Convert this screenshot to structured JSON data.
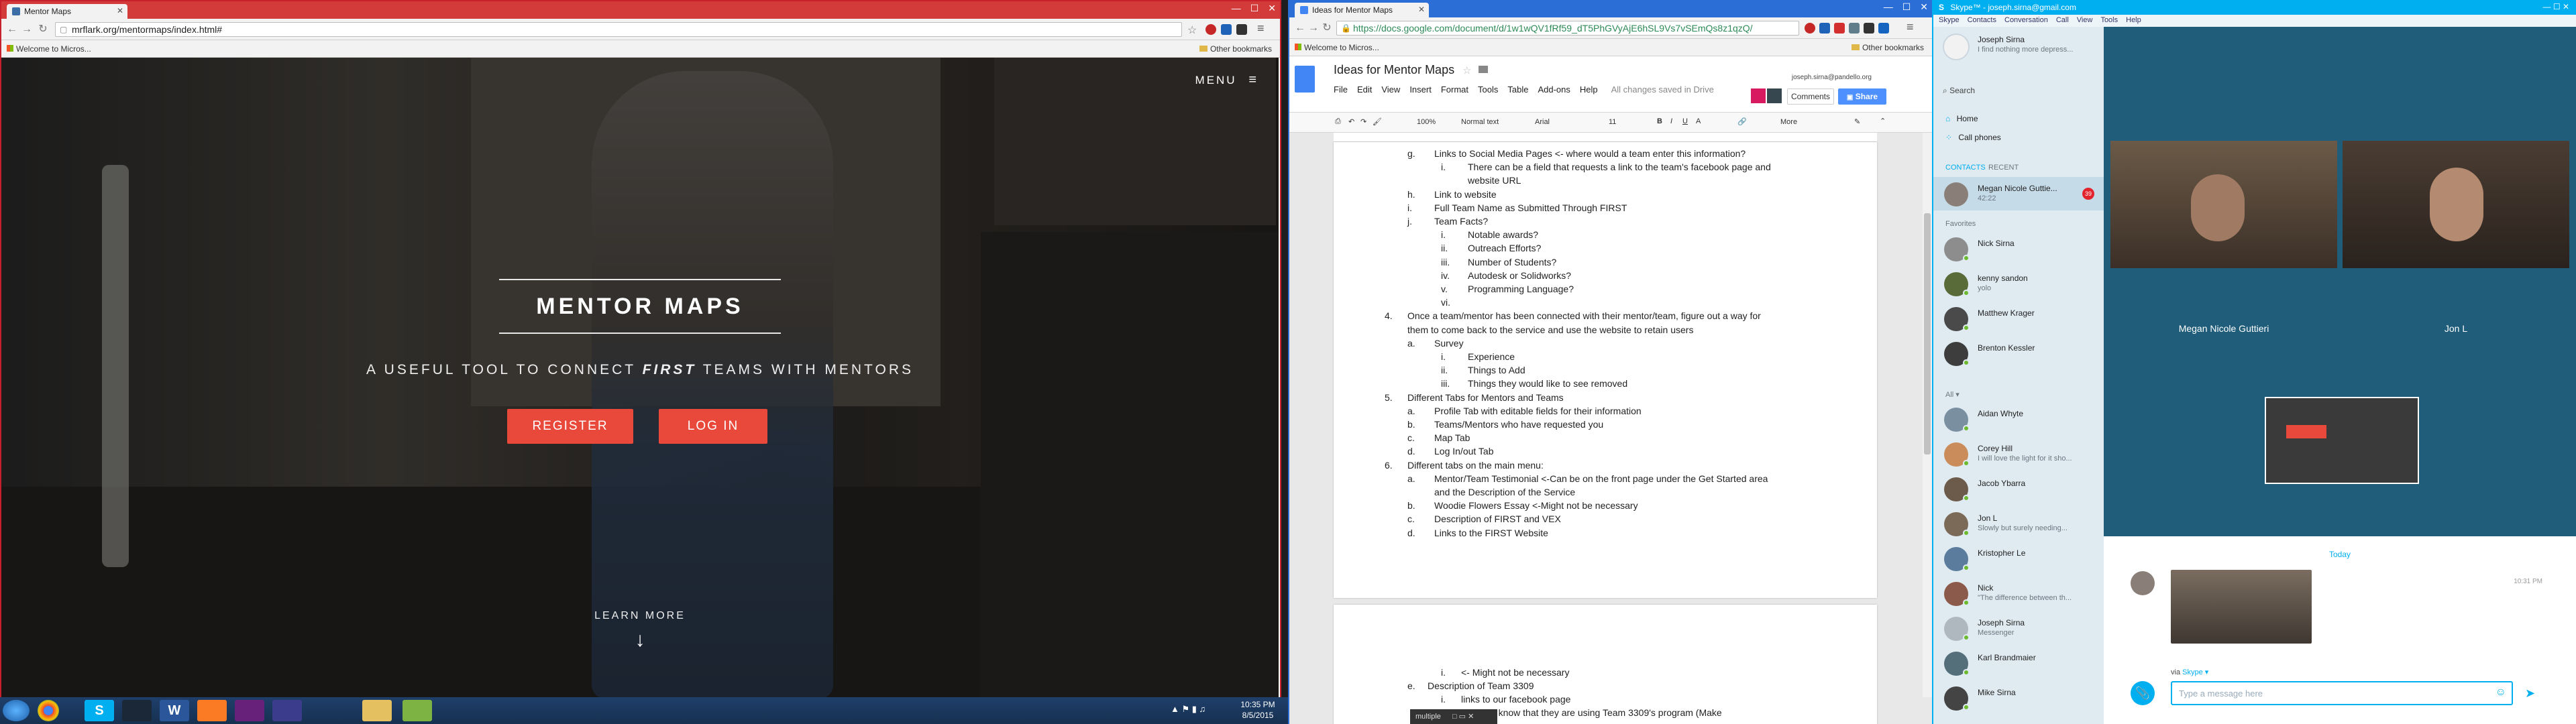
{
  "chrome_left": {
    "tab_title": "Mentor Maps",
    "url": "mrflark.org/mentormaps/index.html#",
    "bookmark": "Welcome to Micros...",
    "other_bookmarks": "Other bookmarks"
  },
  "mentor_site": {
    "menu_label": "MENU",
    "title": "MENTOR MAPS",
    "subtitle_pre": "A USEFUL TOOL TO CONNECT ",
    "subtitle_em": "FIRST",
    "subtitle_post": " TEAMS WITH MENTORS",
    "register": "REGISTER",
    "login": "LOG IN",
    "learn_more": "LEARN MORE"
  },
  "taskbar": {
    "time": "10:35 PM",
    "date": "8/5/2015"
  },
  "chrome_docs": {
    "tab_title": "Ideas for Mentor Maps",
    "url": "https://docs.google.com/document/d/1w1wQV1fRf59_dT5PhGVyAjE6hSL9Vs7vSEmQs8z1qzQ/",
    "bookmark": "Welcome to Micros...",
    "other_bookmarks": "Other bookmarks"
  },
  "docs": {
    "doc_title": "Ideas for Mentor Maps",
    "account": "joseph.sirna@pandello.org",
    "menu": [
      "File",
      "Edit",
      "View",
      "Insert",
      "Format",
      "Tools",
      "Table",
      "Add-ons",
      "Help"
    ],
    "saved": "All changes saved in Drive",
    "comments": "Comments",
    "share": "Share",
    "zoom": "100%",
    "style": "Normal text",
    "font": "Arial",
    "size": "11",
    "more": "More",
    "lines": [
      {
        "m": "g.",
        "t": "Links to Social Media Pages <- where would a team enter this information?"
      },
      {
        "m": "i.",
        "t": "There can be a field that requests a link to the team's facebook page and"
      },
      {
        "m": "",
        "t": "website URL"
      },
      {
        "m": "h.",
        "t": "Link to website"
      },
      {
        "m": "i.",
        "t": "Full Team Name as Submitted Through FIRST"
      },
      {
        "m": "j.",
        "t": "Team Facts?"
      },
      {
        "m": "i.",
        "t": "Notable awards?"
      },
      {
        "m": "ii.",
        "t": "Outreach Efforts?"
      },
      {
        "m": "iii.",
        "t": "Number of Students?"
      },
      {
        "m": "iv.",
        "t": "Autodesk or Solidworks?"
      },
      {
        "m": "v.",
        "t": "Programming Language?"
      },
      {
        "m": "vi.",
        "t": ""
      },
      {
        "m": "4.",
        "t": "Once a team/mentor has been connected with their mentor/team, figure out a way for"
      },
      {
        "m": "",
        "t": "them to come back to the service and use the website to retain users"
      },
      {
        "m": "a.",
        "t": "Survey"
      },
      {
        "m": "i.",
        "t": "Experience"
      },
      {
        "m": "ii.",
        "t": "Things to Add"
      },
      {
        "m": "iii.",
        "t": "Things they would like to see removed"
      },
      {
        "m": "5.",
        "t": "Different Tabs for Mentors and Teams"
      },
      {
        "m": "a.",
        "t": "Profile Tab with editable fields for their information"
      },
      {
        "m": "b.",
        "t": "Teams/Mentors who have requested you"
      },
      {
        "m": "c.",
        "t": "Map Tab"
      },
      {
        "m": "d.",
        "t": "Log In/out Tab"
      },
      {
        "m": "6.",
        "t": "Different tabs on the main menu:"
      },
      {
        "m": "a.",
        "t": "Mentor/Team Testimonial <-Can be on the front page under the Get Started area"
      },
      {
        "m": "",
        "t": "and the Description of the Service"
      },
      {
        "m": "b.",
        "t": "Woodie Flowers Essay <-Might not be necessary"
      },
      {
        "m": "c.",
        "t": "Description of FIRST and VEX"
      },
      {
        "m": "d.",
        "t": "Links to the FIRST Website"
      }
    ],
    "page2": [
      {
        "m": "i.",
        "t": "<- Might not be necessary"
      },
      {
        "m": "e.",
        "t": "Description of Team 3309"
      },
      {
        "m": "i.",
        "t": "links to our facebook page"
      },
      {
        "m": "",
        "t": "to know that they are using Team 3309's program (Make"
      }
    ],
    "statusbar": "multiple"
  },
  "skype": {
    "title": "Skype™ - joseph.sirna@gmail.com",
    "menu": [
      "Skype",
      "Contacts",
      "Conversation",
      "Call",
      "View",
      "Tools",
      "Help"
    ],
    "me_name": "Joseph Sirna",
    "me_mood": "I find nothing more depress...",
    "search": "Search",
    "home": "Home",
    "call_phones": "Call phones",
    "tab_contacts": "CONTACTS",
    "tab_recent": "RECENT",
    "active_contact": {
      "name": "Megan Nicole Guttie...",
      "status": "42:22",
      "badge": "39"
    },
    "favorites_label": "Favorites",
    "all_label": "All",
    "favorites": [
      {
        "name": "Nick Sirna",
        "status": ""
      },
      {
        "name": "kenny sandon",
        "status": "yolo"
      },
      {
        "name": "Matthew Krager",
        "status": ""
      },
      {
        "name": "Brenton Kessler",
        "status": ""
      }
    ],
    "all": [
      {
        "name": "Aidan Whyte",
        "status": ""
      },
      {
        "name": "Corey Hill",
        "status": "I will love the light for it sho..."
      },
      {
        "name": "Jacob Ybarra",
        "status": ""
      },
      {
        "name": "Jon L",
        "status": "Slowly but surely needing..."
      },
      {
        "name": "Kristopher Le",
        "status": ""
      },
      {
        "name": "Nick",
        "status": "\"The difference between th..."
      },
      {
        "name": "Joseph Sirna",
        "status": "Messenger"
      },
      {
        "name": "Karl Brandmaier",
        "status": ""
      },
      {
        "name": "Mike Sirna",
        "status": ""
      }
    ],
    "call": {
      "participant1": "Megan Nicole Guttieri",
      "participant2": "Jon L"
    },
    "chat": {
      "day": "Today",
      "time": "10:31 PM",
      "via_label": "via",
      "via": "Skype",
      "placeholder": "Type a message here"
    }
  }
}
